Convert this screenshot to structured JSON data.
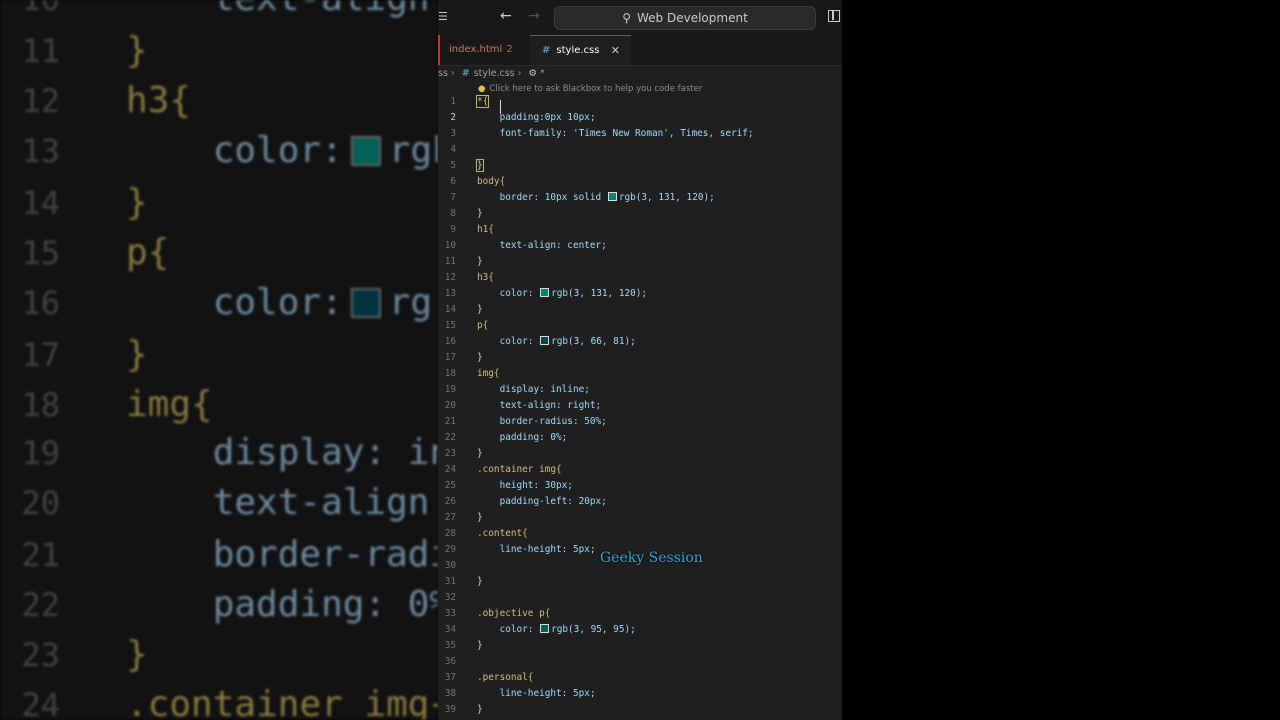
{
  "background_zoom": {
    "lines": [
      {
        "num": "10",
        "text": "text-align:"
      },
      {
        "num": "11",
        "text": "}"
      },
      {
        "num": "12",
        "text": "h3{"
      },
      {
        "num": "13",
        "text": "color:",
        "swatch": true,
        "tail": "rgb"
      },
      {
        "num": "14",
        "text": "}"
      },
      {
        "num": "15",
        "text": "p{"
      },
      {
        "num": "16",
        "text": "color:",
        "swatch": true,
        "tail": "rg"
      },
      {
        "num": "17",
        "text": "}"
      },
      {
        "num": "18",
        "text": "img{"
      },
      {
        "num": "19",
        "text": "display: in"
      },
      {
        "num": "20",
        "text": "text-align:"
      },
      {
        "num": "21",
        "text": "border-radiu"
      },
      {
        "num": "22",
        "text": "padding: 0%"
      },
      {
        "num": "23",
        "text": "}"
      },
      {
        "num": "24",
        "text": ".container img{"
      }
    ]
  },
  "titlebar": {
    "search_label": "Web Development"
  },
  "tabs": [
    {
      "label": "index.html",
      "count": "2"
    },
    {
      "label": "style.css",
      "active": true
    }
  ],
  "breadcrumb": {
    "prefix": "ss",
    "file": "style.css",
    "symbol": "*"
  },
  "hint": {
    "text": "Click here to ask Blackbox to help you code faster"
  },
  "code_lines": [
    {
      "n": "1",
      "text": "*{"
    },
    {
      "n": "2",
      "text": "    padding:0px 10px;"
    },
    {
      "n": "3",
      "text": "    font-family: 'Times New Roman', Times, serif;"
    },
    {
      "n": "4",
      "text": ""
    },
    {
      "n": "5",
      "text": "}"
    },
    {
      "n": "6",
      "text": "body{"
    },
    {
      "n": "7",
      "text": "    border: 10px solid rgb(3, 131, 120);"
    },
    {
      "n": "8",
      "text": "}"
    },
    {
      "n": "9",
      "text": "h1{"
    },
    {
      "n": "10",
      "text": "    text-align: center;"
    },
    {
      "n": "11",
      "text": "}"
    },
    {
      "n": "12",
      "text": "h3{"
    },
    {
      "n": "13",
      "text": "    color: rgb(3, 131, 120);"
    },
    {
      "n": "14",
      "text": "}"
    },
    {
      "n": "15",
      "text": "p{"
    },
    {
      "n": "16",
      "text": "    color: rgb(3, 66, 81);"
    },
    {
      "n": "17",
      "text": "}"
    },
    {
      "n": "18",
      "text": "img{"
    },
    {
      "n": "19",
      "text": "    display: inline;"
    },
    {
      "n": "20",
      "text": "    text-align: right;"
    },
    {
      "n": "21",
      "text": "    border-radius: 50%;"
    },
    {
      "n": "22",
      "text": "    padding: 0%;"
    },
    {
      "n": "23",
      "text": "}"
    },
    {
      "n": "24",
      "text": ".container img{"
    },
    {
      "n": "25",
      "text": "    height: 30px;"
    },
    {
      "n": "26",
      "text": "    padding-left: 20px;"
    },
    {
      "n": "27",
      "text": "}"
    },
    {
      "n": "28",
      "text": ".content{"
    },
    {
      "n": "29",
      "text": "    line-height: 5px;"
    },
    {
      "n": "30",
      "text": ""
    },
    {
      "n": "31",
      "text": "}"
    },
    {
      "n": "32",
      "text": ""
    },
    {
      "n": "33",
      "text": ".objective p{"
    },
    {
      "n": "34",
      "text": "    color: rgb(3, 95, 95);"
    },
    {
      "n": "35",
      "text": "}"
    },
    {
      "n": "36",
      "text": ""
    },
    {
      "n": "37",
      "text": ".personal{"
    },
    {
      "n": "38",
      "text": "    line-height: 5px;"
    },
    {
      "n": "39",
      "text": "}"
    }
  ],
  "swatch_colors": {
    "teal": "#038378",
    "dark_teal": "#034251",
    "teal2": "#035f5f"
  },
  "watermark": "Geeky Session"
}
